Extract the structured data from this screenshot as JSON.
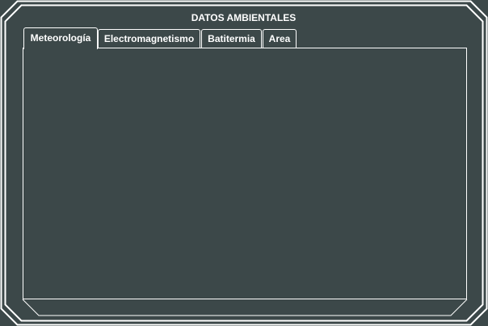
{
  "panel": {
    "title": "DATOS AMBIENTALES"
  },
  "tabs": [
    {
      "label": "Meteorología",
      "selected": true
    },
    {
      "label": "Electromagnetismo",
      "selected": false
    },
    {
      "label": "Batitermia",
      "selected": false
    },
    {
      "label": "Area",
      "selected": false
    }
  ],
  "colors": {
    "background": "#3c4849",
    "foreground": "#ffffff"
  }
}
